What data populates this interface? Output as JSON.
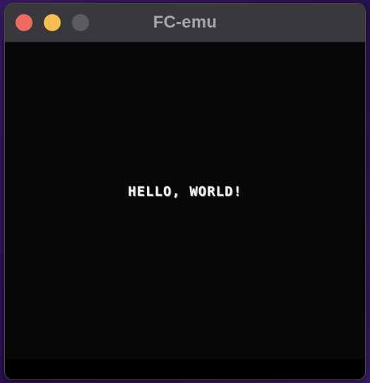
{
  "window": {
    "title": "FC-emu",
    "controls": {
      "close": {
        "icon": "close-icon",
        "color": "#ec6a5f"
      },
      "minimize": {
        "icon": "minimize-icon",
        "color": "#f4bf4f"
      },
      "zoom": {
        "icon": "zoom-icon",
        "color": "#5c5b60",
        "state": "disabled"
      }
    }
  },
  "screen": {
    "text": "HELLO, WORLD!",
    "background": "#080808",
    "text_color": "#f2f2f2"
  }
}
